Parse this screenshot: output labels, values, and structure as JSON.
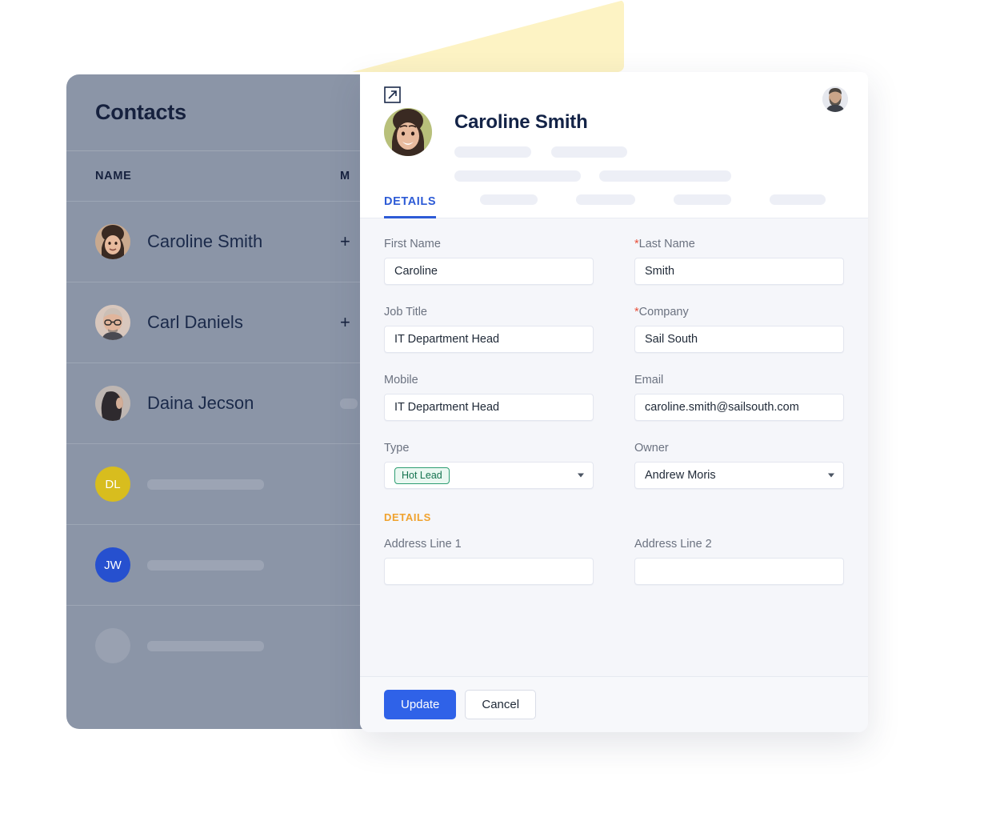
{
  "background_panel": {
    "title": "Contacts",
    "columns": [
      "NAME",
      "M"
    ],
    "rows": [
      {
        "name": "Caroline Smith",
        "mobile": "+",
        "avatar": "photo-woman-dark-hair",
        "name_hidden": false
      },
      {
        "name": "Carl Daniels",
        "mobile": "+",
        "avatar": "photo-man-glasses",
        "name_hidden": false
      },
      {
        "name": "Daina Jecson",
        "mobile": "",
        "avatar": "photo-woman-profile",
        "name_hidden": false
      },
      {
        "name": "",
        "mobile": "+",
        "avatar": "initials",
        "initials": "DL",
        "initials_color": "#D8BD1E",
        "name_hidden": true
      },
      {
        "name": "",
        "mobile": "",
        "avatar": "initials",
        "initials": "JW",
        "initials_color": "#2650CF",
        "name_hidden": true
      },
      {
        "name": "",
        "mobile": "",
        "avatar": "blank",
        "initials": "",
        "name_hidden": true
      }
    ]
  },
  "modal": {
    "expand_icon": "open-in-new-icon",
    "header_avatar": "user-avatar-bearded-man",
    "contact_avatar": "photo-woman-dark-hair",
    "contact_name": "Caroline Smith",
    "tabs": {
      "active_label": "DETAILS",
      "placeholder_widths": [
        72,
        74,
        72,
        70
      ]
    },
    "form": {
      "fields": [
        {
          "label": "First Name",
          "required": false,
          "value": "Caroline",
          "type": "text",
          "name": "first-name"
        },
        {
          "label": "Last Name",
          "required": true,
          "value": "Smith",
          "type": "text",
          "name": "last-name"
        },
        {
          "label": "Job Title",
          "required": false,
          "value": "IT Department Head",
          "type": "text",
          "name": "job-title"
        },
        {
          "label": "Company",
          "required": true,
          "value": "Sail South",
          "type": "text",
          "name": "company"
        },
        {
          "label": "Mobile",
          "required": false,
          "value": "IT Department Head",
          "type": "text",
          "name": "mobile"
        },
        {
          "label": "Email",
          "required": false,
          "value": "caroline.smith@sailsouth.com",
          "type": "text",
          "name": "email"
        },
        {
          "label": "Type",
          "required": false,
          "value": "Hot Lead",
          "type": "select-pill",
          "name": "type"
        },
        {
          "label": "Owner",
          "required": false,
          "value": "Andrew Moris",
          "type": "select",
          "name": "owner"
        }
      ],
      "section_title": "DETAILS",
      "address_fields": [
        {
          "label": "Address Line 1",
          "value": "",
          "name": "address-line-1"
        },
        {
          "label": "Address Line 2",
          "value": "",
          "name": "address-line-2"
        }
      ]
    },
    "footer": {
      "update_label": "Update",
      "cancel_label": "Cancel"
    }
  },
  "colors": {
    "panel": "#8B95A7",
    "primary_blue": "#2F62E8",
    "tab_blue": "#2D5BD6",
    "required_star": "#E8503A",
    "section_orange": "#F0A22E",
    "pill_green_text": "#14734F",
    "pill_green_border": "#2E9E73",
    "pill_green_bg": "#EAF8F1",
    "accent_yellow": "#FDF3C4",
    "modal_bg": "#F5F6FA"
  }
}
